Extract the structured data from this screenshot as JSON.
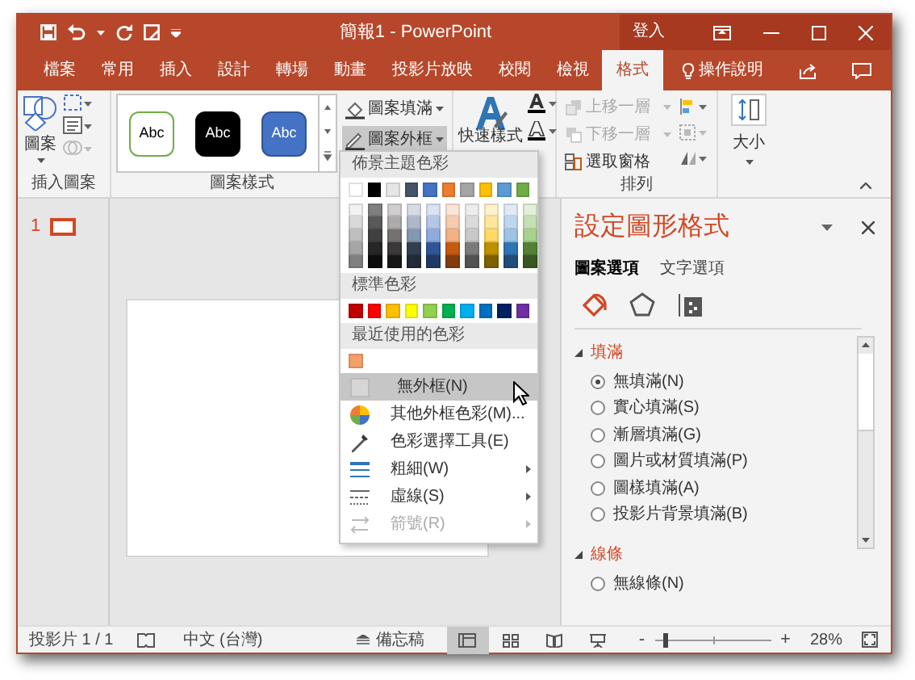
{
  "window": {
    "title": "簡報1 - PowerPoint",
    "sign_in": "登入"
  },
  "ribbon_tabs": [
    {
      "label": "檔案",
      "selected": false
    },
    {
      "label": "常用",
      "selected": false
    },
    {
      "label": "插入",
      "selected": false
    },
    {
      "label": "設計",
      "selected": false
    },
    {
      "label": "轉場",
      "selected": false
    },
    {
      "label": "動畫",
      "selected": false
    },
    {
      "label": "投影片放映",
      "selected": false
    },
    {
      "label": "校閱",
      "selected": false
    },
    {
      "label": "檢視",
      "selected": false
    },
    {
      "label": "格式",
      "selected": true
    }
  ],
  "tell_me": "操作說明",
  "insert_shapes": {
    "shapes_button": "圖案",
    "label": "插入圖案"
  },
  "shape_styles": {
    "presets": [
      {
        "label": "Abc",
        "kind": "outline"
      },
      {
        "label": "Abc",
        "kind": "black"
      },
      {
        "label": "Abc",
        "kind": "blue"
      }
    ],
    "buttons": [
      {
        "label": "圖案填滿",
        "kind": "fill",
        "expanded": false
      },
      {
        "label": "圖案外框",
        "kind": "outline",
        "expanded": true
      }
    ],
    "label": "圖案樣式"
  },
  "wordart": {
    "quick_styles": "快速樣式"
  },
  "arrange": {
    "items": [
      {
        "label": "上移一層",
        "disabled": true
      },
      {
        "label": "下移一層",
        "disabled": true
      },
      {
        "label": "選取窗格",
        "disabled": false
      }
    ],
    "label": "排列"
  },
  "size": {
    "button": "大小"
  },
  "slides": [
    {
      "number": "1",
      "selected": true
    }
  ],
  "outline_menu": {
    "theme_header": "佈景主題色彩",
    "theme_colors": [
      {
        "color": "#ffffff",
        "shades": [
          {
            "color": "#f2f2f2"
          },
          {
            "color": "#d9d9d9"
          },
          {
            "color": "#bfbfbf"
          },
          {
            "color": "#a6a6a6"
          },
          {
            "color": "#808080"
          }
        ]
      },
      {
        "color": "#000000",
        "shades": [
          {
            "color": "#7f7f7f"
          },
          {
            "color": "#595959"
          },
          {
            "color": "#404040"
          },
          {
            "color": "#262626"
          },
          {
            "color": "#0d0d0d"
          }
        ]
      },
      {
        "color": "#e7e6e6",
        "shades": [
          {
            "color": "#d0cece"
          },
          {
            "color": "#aeabab"
          },
          {
            "color": "#757171"
          },
          {
            "color": "#3a3838"
          },
          {
            "color": "#171616"
          }
        ]
      },
      {
        "color": "#44546a",
        "shades": [
          {
            "color": "#d6dce5"
          },
          {
            "color": "#adb9ca"
          },
          {
            "color": "#8497b0"
          },
          {
            "color": "#333f50"
          },
          {
            "color": "#222a35"
          }
        ]
      },
      {
        "color": "#4472c4",
        "shades": [
          {
            "color": "#dae3f3"
          },
          {
            "color": "#b4c7e7"
          },
          {
            "color": "#8faadc"
          },
          {
            "color": "#2f5597"
          },
          {
            "color": "#203864"
          }
        ]
      },
      {
        "color": "#ed7d31",
        "shades": [
          {
            "color": "#fbe5d6"
          },
          {
            "color": "#f8cbad"
          },
          {
            "color": "#f4b183"
          },
          {
            "color": "#c55a11"
          },
          {
            "color": "#843c0c"
          }
        ]
      },
      {
        "color": "#a5a5a5",
        "shades": [
          {
            "color": "#ededed"
          },
          {
            "color": "#dbdbdb"
          },
          {
            "color": "#c9c9c9"
          },
          {
            "color": "#7b7b7b"
          },
          {
            "color": "#525252"
          }
        ]
      },
      {
        "color": "#ffc000",
        "shades": [
          {
            "color": "#fff2cc"
          },
          {
            "color": "#ffe699"
          },
          {
            "color": "#ffd966"
          },
          {
            "color": "#bf9000"
          },
          {
            "color": "#7f6000"
          }
        ]
      },
      {
        "color": "#5b9bd5",
        "shades": [
          {
            "color": "#deebf7"
          },
          {
            "color": "#bdd7ee"
          },
          {
            "color": "#9dc3e6"
          },
          {
            "color": "#2e75b6"
          },
          {
            "color": "#1f4e79"
          }
        ]
      },
      {
        "color": "#70ad47",
        "shades": [
          {
            "color": "#e2f0d9"
          },
          {
            "color": "#c5e0b4"
          },
          {
            "color": "#a9d18e"
          },
          {
            "color": "#548235"
          },
          {
            "color": "#385723"
          }
        ]
      }
    ],
    "standard_header": "標準色彩",
    "standard_colors": [
      {
        "color": "#c00000"
      },
      {
        "color": "#ff0000"
      },
      {
        "color": "#ffc000"
      },
      {
        "color": "#ffff00"
      },
      {
        "color": "#92d050"
      },
      {
        "color": "#00b050"
      },
      {
        "color": "#00b0f0"
      },
      {
        "color": "#0070c0"
      },
      {
        "color": "#002060"
      },
      {
        "color": "#7030a0"
      }
    ],
    "recent_header": "最近使用的色彩",
    "recent_colors": [
      {
        "color": "#f4a06a"
      }
    ],
    "items": [
      {
        "label": "無外框(N)",
        "kind": "none",
        "highlighted": true,
        "disabled": false,
        "submenu": false
      },
      {
        "label": "其他外框色彩(M)...",
        "kind": "more",
        "highlighted": false,
        "disabled": false,
        "submenu": false
      },
      {
        "label": "色彩選擇工具(E)",
        "kind": "eyedropper",
        "highlighted": false,
        "disabled": false,
        "submenu": false
      },
      {
        "label": "粗細(W)",
        "kind": "weight",
        "highlighted": false,
        "disabled": false,
        "submenu": true
      },
      {
        "label": "虛線(S)",
        "kind": "dashes",
        "highlighted": false,
        "disabled": false,
        "submenu": true
      },
      {
        "label": "箭號(R)",
        "kind": "arrows",
        "highlighted": false,
        "disabled": true,
        "submenu": true
      }
    ]
  },
  "format_pane": {
    "title": "設定圖形格式",
    "tabs": [
      {
        "label": "圖案選項",
        "selected": true
      },
      {
        "label": "文字選項",
        "selected": false
      }
    ],
    "icon_tabs": [
      {
        "kind": "fill",
        "selected": true
      },
      {
        "kind": "effects",
        "selected": false
      },
      {
        "kind": "size",
        "selected": false
      }
    ],
    "sections": [
      {
        "title": "填滿",
        "expanded": true,
        "options": [
          {
            "label": "無填滿(N)",
            "selected": true
          },
          {
            "label": "實心填滿(S)",
            "selected": false
          },
          {
            "label": "漸層填滿(G)",
            "selected": false
          },
          {
            "label": "圖片或材質填滿(P)",
            "selected": false
          },
          {
            "label": "圖樣填滿(A)",
            "selected": false
          },
          {
            "label": "投影片背景填滿(B)",
            "selected": false
          }
        ]
      },
      {
        "title": "線條",
        "expanded": true,
        "options": [
          {
            "label": "無線條(N)",
            "selected": false
          }
        ]
      }
    ]
  },
  "status_bar": {
    "slide": "投影片 1 / 1",
    "language": "中文 (台灣)",
    "notes": "備忘稿",
    "views": [
      {
        "kind": "normal",
        "selected": true
      },
      {
        "kind": "sorter",
        "selected": false
      },
      {
        "kind": "reading",
        "selected": false
      },
      {
        "kind": "show",
        "selected": false
      }
    ],
    "zoom_minus": "-",
    "zoom_plus": "+",
    "zoom": {
      "level": 0.1
    },
    "zoom_text": "28%"
  }
}
